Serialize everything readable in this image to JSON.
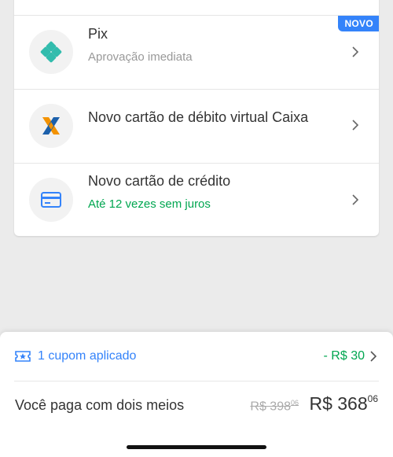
{
  "payment_methods": {
    "pix": {
      "title": "Pix",
      "subtitle": "Aprovação imediata",
      "badge": "NOVO",
      "icon": "pix-icon",
      "subtitle_color": "#999999"
    },
    "caixa": {
      "title": "Novo cartão de débito virtual Caixa",
      "icon": "caixa-icon"
    },
    "credit": {
      "title": "Novo cartão de crédito",
      "subtitle": "Até 12 vezes sem juros",
      "icon": "credit-card-icon",
      "subtitle_color": "#00a650"
    }
  },
  "summary": {
    "coupon_label": "1 cupom aplicado",
    "discount": "- R$ 30",
    "pay_label": "Você paga com dois meios",
    "old_price_main": "R$ 398",
    "old_price_cents": "06",
    "new_price_main": "R$ 368",
    "new_price_cents": "06"
  },
  "colors": {
    "accent": "#3483fa",
    "success": "#00a650",
    "background": "#ebebeb"
  }
}
